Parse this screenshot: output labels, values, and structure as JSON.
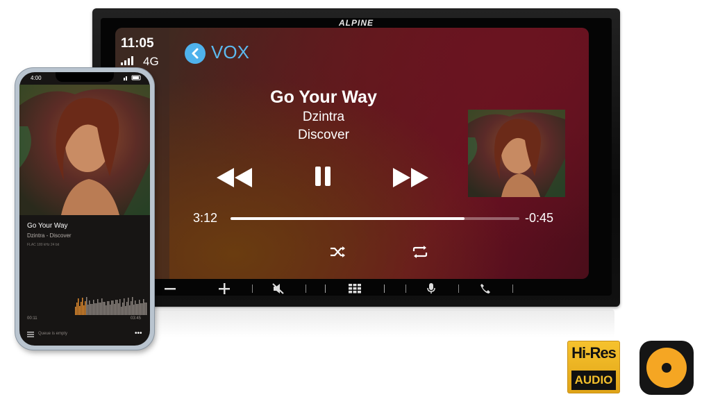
{
  "head_unit": {
    "brand": "ALPINE",
    "status": {
      "time": "11:05",
      "network": "4G"
    },
    "app": {
      "name": "VOX"
    },
    "now_playing": {
      "title": "Go Your Way",
      "artist": "Dzintra",
      "album": "Discover",
      "elapsed": "3:12",
      "remaining": "-0:45",
      "progress_fraction": 0.81
    },
    "controls": [
      "rewind-icon",
      "pause-icon",
      "fast-forward-icon",
      "shuffle-icon",
      "repeat-icon"
    ],
    "hardware_buttons": [
      "volume-down-icon",
      "volume-up-icon",
      "mute-icon",
      "menu-grid-icon",
      "microphone-icon",
      "phone-icon"
    ],
    "accent_color": "#4fb2ec"
  },
  "phone": {
    "status_time": "4:00",
    "now_playing": {
      "title": "Go Your Way",
      "subtitle": "Dzintra - Discover",
      "format": "FLAC 180 kHz 24 bit",
      "elapsed": "00:11",
      "duration": "03:45"
    },
    "queue_text": "Queue is empty",
    "waveform_accent": "#e08a2e"
  },
  "badges": {
    "hires_top": "Hi-Res",
    "hires_bottom": "AUDIO",
    "vox_color": "#f5a623"
  }
}
